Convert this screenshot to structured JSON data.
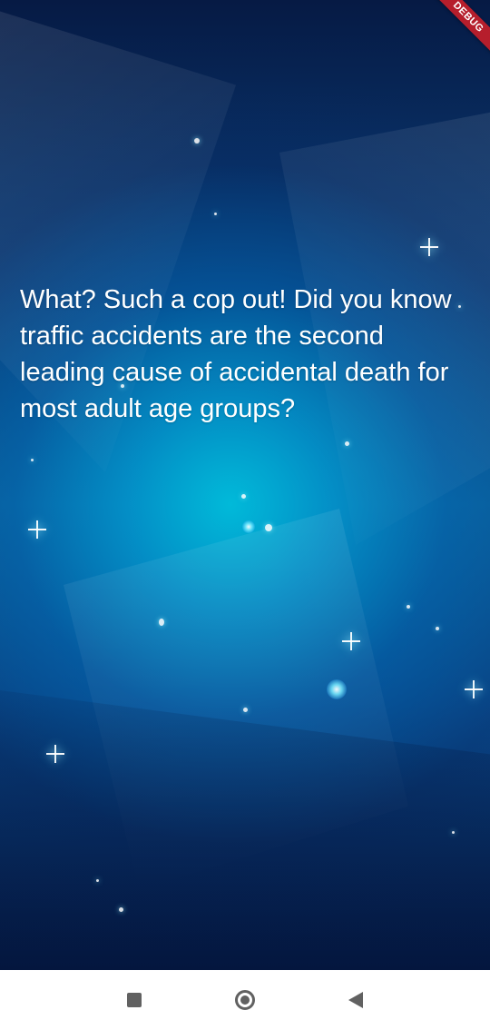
{
  "app": {
    "debug_banner": "DEBUG"
  },
  "content": {
    "message": "What? Such a cop out! Did you know traffic accidents are the second leading cause of accidental death for most adult age groups?"
  },
  "navigation": {
    "recent_icon": "square-recent-apps-icon",
    "home_icon": "circle-home-icon",
    "back_icon": "triangle-back-icon"
  },
  "theme": {
    "background_primary": "#0a4b8d",
    "background_glow": "#00bedc",
    "text_color": "#ffffff",
    "debug_ribbon_color": "#b61e2c",
    "navbar_background": "#ffffff",
    "navbar_icon_color": "#616161"
  }
}
